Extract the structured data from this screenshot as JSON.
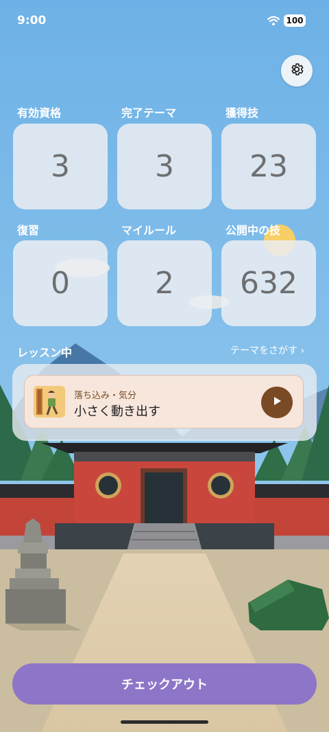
{
  "status_bar": {
    "time": "9:00",
    "battery": "100"
  },
  "stats": [
    {
      "label": "有効資格",
      "value": "3"
    },
    {
      "label": "完了テーマ",
      "value": "3"
    },
    {
      "label": "獲得技",
      "value": "23"
    },
    {
      "label": "復習",
      "value": "0"
    },
    {
      "label": "マイルール",
      "value": "2"
    },
    {
      "label": "公開中の技",
      "value": "632"
    }
  ],
  "lessons": {
    "section_label": "レッスン中",
    "theme_link": "テーマをさがす ›",
    "current": {
      "category": "落ち込み・気分",
      "title": "小さく動き出す"
    }
  },
  "checkout": {
    "label": "チェックアウト"
  },
  "icons": [
    "wifi-icon",
    "gear-icon",
    "play-icon"
  ]
}
